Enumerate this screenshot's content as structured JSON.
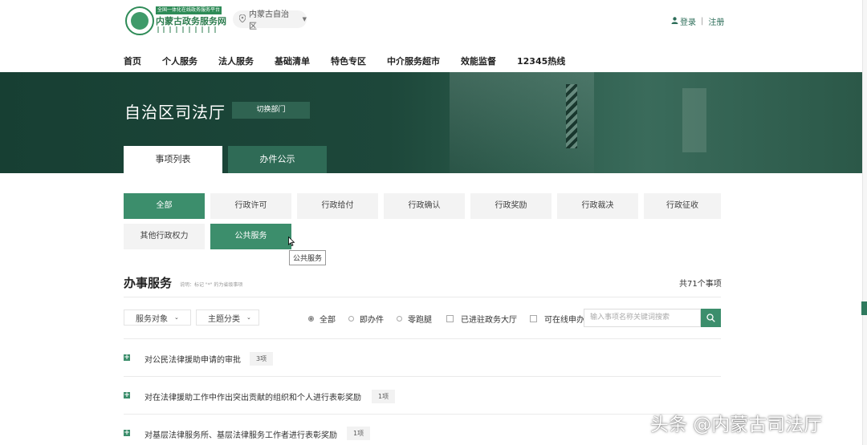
{
  "header": {
    "logo_slogan": "全国一体化在线政务服务平台",
    "logo_name": "内蒙古政务服务网",
    "location": "内蒙古自治区",
    "login": "登录",
    "separator": "|",
    "register": "注册"
  },
  "nav": [
    "首页",
    "个人服务",
    "法人服务",
    "基础清单",
    "特色专区",
    "中介服务超市",
    "效能监督",
    "12345热线"
  ],
  "banner": {
    "dept_title": "自治区司法厅",
    "switch_label": "切换部门",
    "tabs": [
      {
        "label": "事项列表",
        "active": true
      },
      {
        "label": "办件公示",
        "active": false
      }
    ]
  },
  "categories": [
    {
      "label": "全部",
      "active": true
    },
    {
      "label": "行政许可",
      "active": false
    },
    {
      "label": "行政给付",
      "active": false
    },
    {
      "label": "行政确认",
      "active": false
    },
    {
      "label": "行政奖励",
      "active": false
    },
    {
      "label": "行政裁决",
      "active": false
    },
    {
      "label": "行政征收",
      "active": false
    },
    {
      "label": "其他行政权力",
      "active": false
    },
    {
      "label": "公共服务",
      "active": true
    }
  ],
  "tooltip": "公共服务",
  "section": {
    "title": "办事服务",
    "note": "说明：标记 \"*\" 的为省级事项",
    "total": "共71个事项"
  },
  "filters": {
    "dropdowns": [
      "服务对象",
      "主题分类"
    ],
    "radios": [
      {
        "label": "全部",
        "selected": true
      },
      {
        "label": "即办件",
        "selected": false
      },
      {
        "label": "零跑腿",
        "selected": false
      }
    ],
    "checkboxes": [
      "已进驻政务大厅",
      "可在线申办"
    ],
    "search_placeholder": "输入事项名称关键词搜索"
  },
  "items": [
    {
      "title": "对公民法律援助申请的审批",
      "count": "3项"
    },
    {
      "title": "对在法律援助工作中作出突出贡献的组织和个人进行表彰奖励",
      "count": "1项"
    },
    {
      "title": "对基层法律服务所、基层法律服务工作者进行表彰奖励",
      "count": "1项"
    }
  ],
  "watermark": "头条 @内蒙古司法厅",
  "colors": {
    "primary": "#3c8e6c",
    "banner": "#1d473a"
  }
}
